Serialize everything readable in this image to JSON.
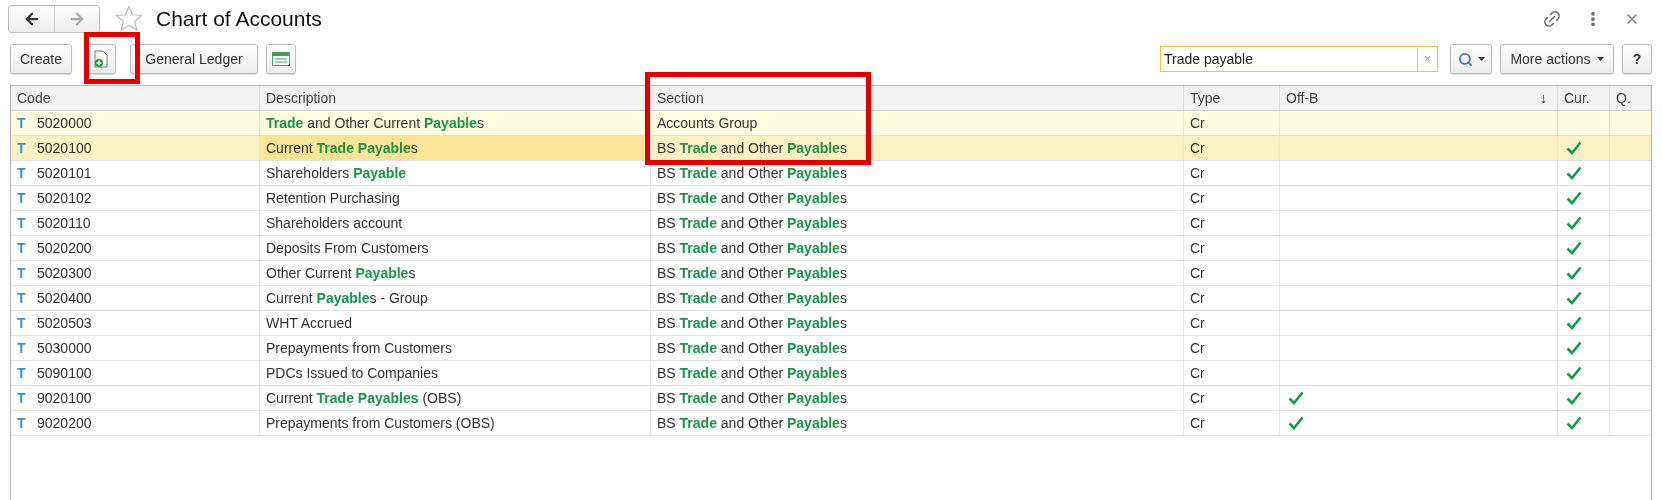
{
  "window": {
    "title": "Chart of Accounts"
  },
  "toolbar": {
    "create": "Create",
    "general_ledger": "General Ledger",
    "search": {
      "value": "Trade payable",
      "clear": "×"
    },
    "more_actions": "More actions",
    "help": "?"
  },
  "table": {
    "columns": [
      {
        "label": "Code"
      },
      {
        "label": "Description"
      },
      {
        "label": "Section"
      },
      {
        "label": "Type"
      },
      {
        "label": "Off-B",
        "sort_mark": "↓"
      },
      {
        "label": "Cur."
      },
      {
        "label": "Q."
      }
    ],
    "rows": [
      {
        "kind": "group",
        "marker": "T",
        "code": "5020000",
        "description": "**Trade** and Other Current **Payable**s",
        "section": "Accounts Group",
        "type": "Cr",
        "off_balance": false,
        "currency": false,
        "selected": false
      },
      {
        "kind": "account",
        "marker": "T",
        "code": "5020100",
        "description": "Current **Trade Payable**s",
        "section": "BS **Trade** and Other **Payable**s",
        "type": "Cr",
        "off_balance": false,
        "currency": true,
        "selected": true
      },
      {
        "kind": "account",
        "marker": "T",
        "code": "5020101",
        "description": "Shareholders **Payable**",
        "section": "BS **Trade** and Other **Payable**s",
        "type": "Cr",
        "off_balance": false,
        "currency": true,
        "selected": false
      },
      {
        "kind": "account",
        "marker": "T",
        "code": "5020102",
        "description": "Retention Purchasing",
        "section": "BS **Trade** and Other **Payable**s",
        "type": "Cr",
        "off_balance": false,
        "currency": true,
        "selected": false
      },
      {
        "kind": "account",
        "marker": "T",
        "code": "5020110",
        "description": "Shareholders account",
        "section": "BS **Trade** and Other **Payable**s",
        "type": "Cr",
        "off_balance": false,
        "currency": true,
        "selected": false
      },
      {
        "kind": "account",
        "marker": "T",
        "code": "5020200",
        "description": "Deposits From Customers",
        "section": "BS **Trade** and Other **Payable**s",
        "type": "Cr",
        "off_balance": false,
        "currency": true,
        "selected": false
      },
      {
        "kind": "account",
        "marker": "T",
        "code": "5020300",
        "description": "Other Current **Payable**s",
        "section": "BS **Trade** and Other **Payable**s",
        "type": "Cr",
        "off_balance": false,
        "currency": true,
        "selected": false
      },
      {
        "kind": "account",
        "marker": "T",
        "code": "5020400",
        "description": "Current **Payable**s - Group",
        "section": "BS **Trade** and Other **Payable**s",
        "type": "Cr",
        "off_balance": false,
        "currency": true,
        "selected": false
      },
      {
        "kind": "account",
        "marker": "T",
        "code": "5020503",
        "description": "WHT Accrued",
        "section": "BS **Trade** and Other **Payable**s",
        "type": "Cr",
        "off_balance": false,
        "currency": true,
        "selected": false
      },
      {
        "kind": "account",
        "marker": "T",
        "code": "5030000",
        "description": "Prepayments from Customers",
        "section": "BS **Trade** and Other **Payable**s",
        "type": "Cr",
        "off_balance": false,
        "currency": true,
        "selected": false
      },
      {
        "kind": "account",
        "marker": "T",
        "code": "5090100",
        "description": "PDCs Issued to Companies",
        "section": "BS **Trade** and Other **Payable**s",
        "type": "Cr",
        "off_balance": false,
        "currency": true,
        "selected": false
      },
      {
        "kind": "account",
        "marker": "T",
        "code": "9020100",
        "description": "Current **Trade Payables** (OBS)",
        "section": "BS **Trade** and Other **Payable**s",
        "type": "Cr",
        "off_balance": true,
        "currency": true,
        "selected": false
      },
      {
        "kind": "account",
        "marker": "T",
        "code": "9020200",
        "description": "Prepayments from Customers (OBS)",
        "section": "BS **Trade** and Other **Payable**s",
        "type": "Cr",
        "off_balance": true,
        "currency": true,
        "selected": false
      }
    ]
  }
}
